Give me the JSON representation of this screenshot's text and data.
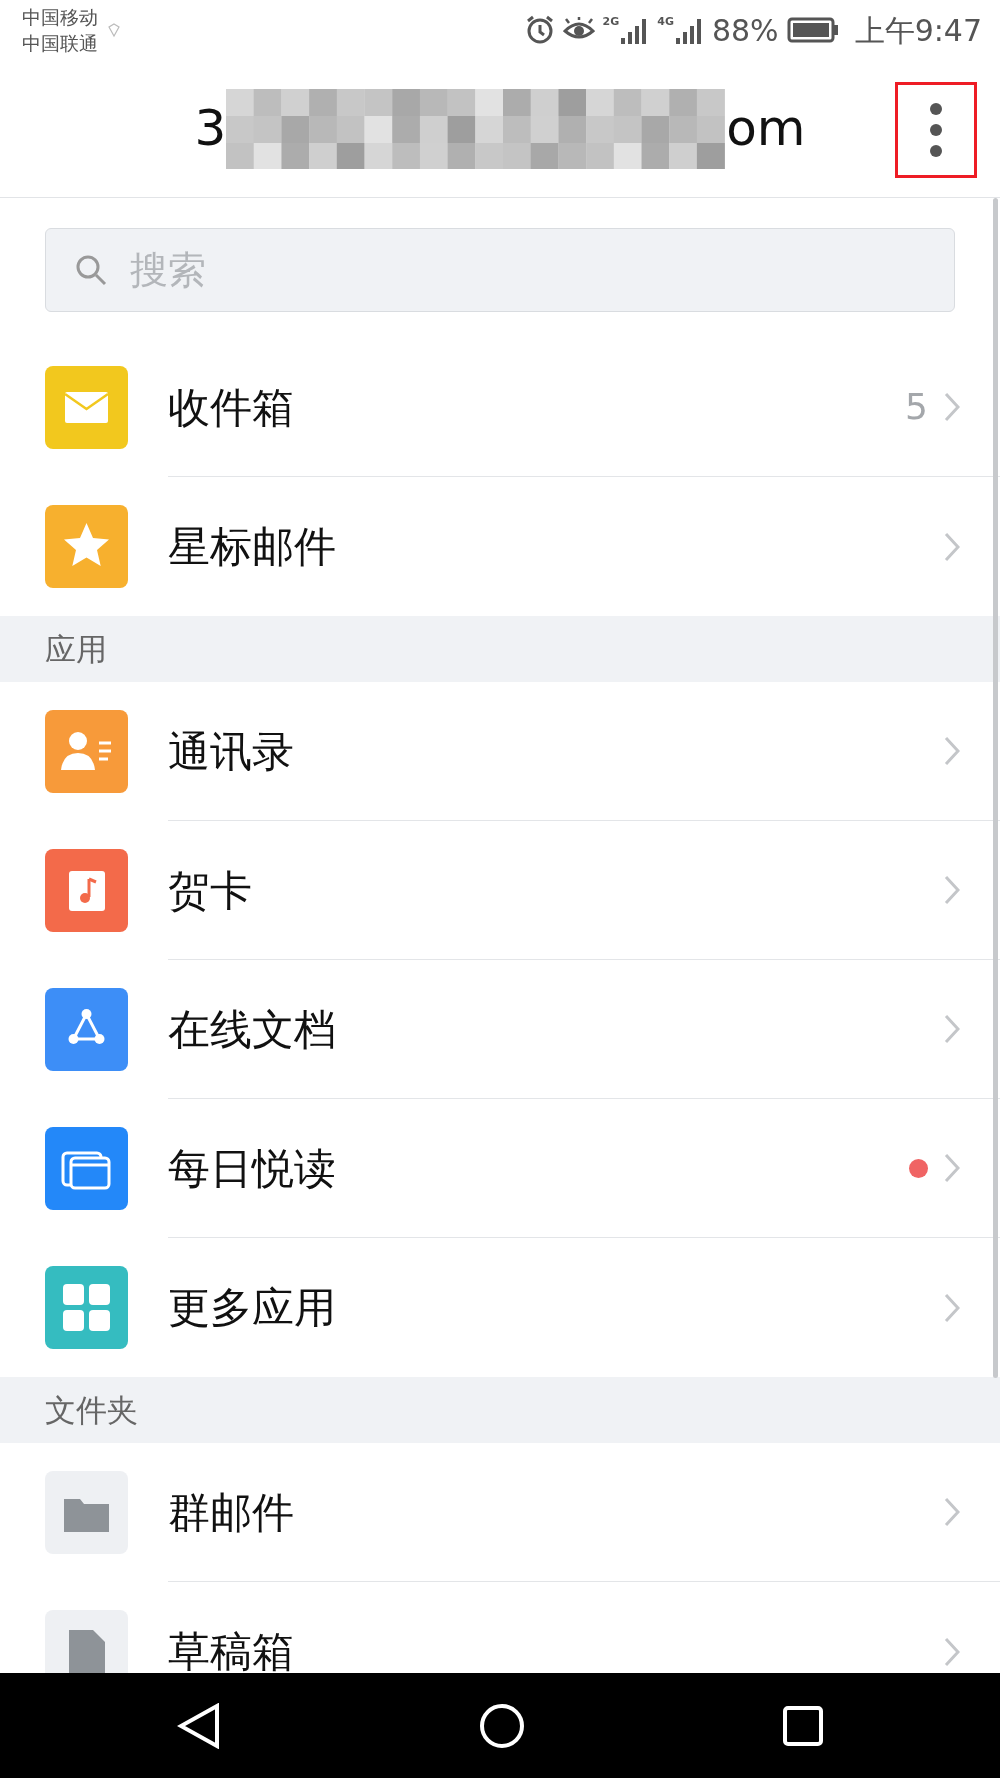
{
  "status_bar": {
    "carriers": [
      "中国移动",
      "中国联通"
    ],
    "network_labels": [
      "2G",
      "4G"
    ],
    "battery": "88%",
    "time": "上午9:47"
  },
  "header": {
    "title_start": "3",
    "title_end": "om",
    "menu_highlighted": true
  },
  "search": {
    "placeholder": "搜索"
  },
  "sections": [
    {
      "items": [
        {
          "label": "收件箱",
          "color": "#f2c81e",
          "count": "5",
          "dot": false
        },
        {
          "label": "星标邮件",
          "color": "#f7b02e",
          "dot": false
        }
      ]
    },
    {
      "title": "应用",
      "items": [
        {
          "label": "通讯录",
          "color": "#f79a3a",
          "dot": false
        },
        {
          "label": "贺卡",
          "color": "#f36a4a",
          "dot": false
        },
        {
          "label": "在线文档",
          "color": "#3d8ef7",
          "dot": false
        },
        {
          "label": "每日悦读",
          "color": "#2388f9",
          "dot": true
        },
        {
          "label": "更多应用",
          "color": "#35bcc0",
          "dot": false
        }
      ]
    },
    {
      "title": "文件夹",
      "items": [
        {
          "label": "群邮件",
          "color": "#eef0f3",
          "dot": false
        },
        {
          "label": "草稿箱",
          "color": "#eef0f3",
          "dot": false
        }
      ]
    }
  ]
}
